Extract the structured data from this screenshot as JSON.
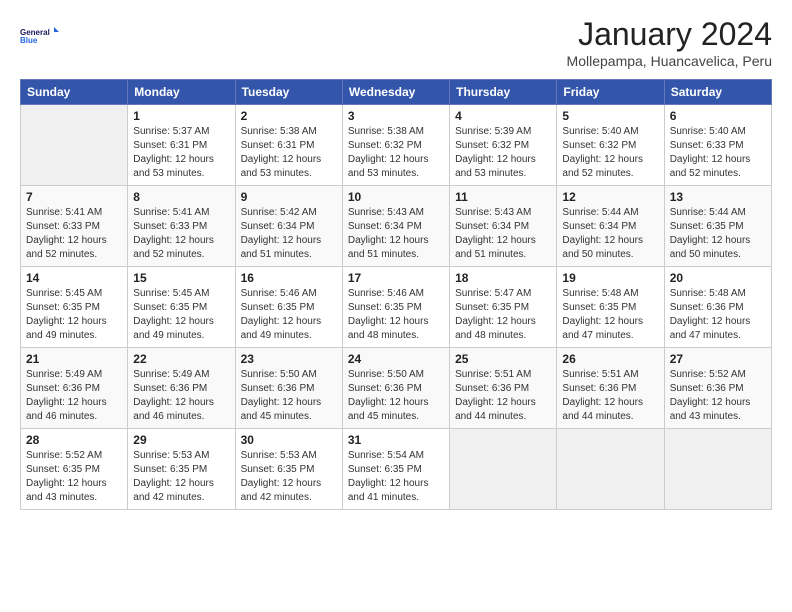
{
  "logo": {
    "line1": "General",
    "line2": "Blue"
  },
  "title": "January 2024",
  "subtitle": "Mollepampa, Huancavelica, Peru",
  "days_header": [
    "Sunday",
    "Monday",
    "Tuesday",
    "Wednesday",
    "Thursday",
    "Friday",
    "Saturday"
  ],
  "weeks": [
    [
      {
        "num": "",
        "info": ""
      },
      {
        "num": "1",
        "info": "Sunrise: 5:37 AM\nSunset: 6:31 PM\nDaylight: 12 hours\nand 53 minutes."
      },
      {
        "num": "2",
        "info": "Sunrise: 5:38 AM\nSunset: 6:31 PM\nDaylight: 12 hours\nand 53 minutes."
      },
      {
        "num": "3",
        "info": "Sunrise: 5:38 AM\nSunset: 6:32 PM\nDaylight: 12 hours\nand 53 minutes."
      },
      {
        "num": "4",
        "info": "Sunrise: 5:39 AM\nSunset: 6:32 PM\nDaylight: 12 hours\nand 53 minutes."
      },
      {
        "num": "5",
        "info": "Sunrise: 5:40 AM\nSunset: 6:32 PM\nDaylight: 12 hours\nand 52 minutes."
      },
      {
        "num": "6",
        "info": "Sunrise: 5:40 AM\nSunset: 6:33 PM\nDaylight: 12 hours\nand 52 minutes."
      }
    ],
    [
      {
        "num": "7",
        "info": "Sunrise: 5:41 AM\nSunset: 6:33 PM\nDaylight: 12 hours\nand 52 minutes."
      },
      {
        "num": "8",
        "info": "Sunrise: 5:41 AM\nSunset: 6:33 PM\nDaylight: 12 hours\nand 52 minutes."
      },
      {
        "num": "9",
        "info": "Sunrise: 5:42 AM\nSunset: 6:34 PM\nDaylight: 12 hours\nand 51 minutes."
      },
      {
        "num": "10",
        "info": "Sunrise: 5:43 AM\nSunset: 6:34 PM\nDaylight: 12 hours\nand 51 minutes."
      },
      {
        "num": "11",
        "info": "Sunrise: 5:43 AM\nSunset: 6:34 PM\nDaylight: 12 hours\nand 51 minutes."
      },
      {
        "num": "12",
        "info": "Sunrise: 5:44 AM\nSunset: 6:34 PM\nDaylight: 12 hours\nand 50 minutes."
      },
      {
        "num": "13",
        "info": "Sunrise: 5:44 AM\nSunset: 6:35 PM\nDaylight: 12 hours\nand 50 minutes."
      }
    ],
    [
      {
        "num": "14",
        "info": "Sunrise: 5:45 AM\nSunset: 6:35 PM\nDaylight: 12 hours\nand 49 minutes."
      },
      {
        "num": "15",
        "info": "Sunrise: 5:45 AM\nSunset: 6:35 PM\nDaylight: 12 hours\nand 49 minutes."
      },
      {
        "num": "16",
        "info": "Sunrise: 5:46 AM\nSunset: 6:35 PM\nDaylight: 12 hours\nand 49 minutes."
      },
      {
        "num": "17",
        "info": "Sunrise: 5:46 AM\nSunset: 6:35 PM\nDaylight: 12 hours\nand 48 minutes."
      },
      {
        "num": "18",
        "info": "Sunrise: 5:47 AM\nSunset: 6:35 PM\nDaylight: 12 hours\nand 48 minutes."
      },
      {
        "num": "19",
        "info": "Sunrise: 5:48 AM\nSunset: 6:35 PM\nDaylight: 12 hours\nand 47 minutes."
      },
      {
        "num": "20",
        "info": "Sunrise: 5:48 AM\nSunset: 6:36 PM\nDaylight: 12 hours\nand 47 minutes."
      }
    ],
    [
      {
        "num": "21",
        "info": "Sunrise: 5:49 AM\nSunset: 6:36 PM\nDaylight: 12 hours\nand 46 minutes."
      },
      {
        "num": "22",
        "info": "Sunrise: 5:49 AM\nSunset: 6:36 PM\nDaylight: 12 hours\nand 46 minutes."
      },
      {
        "num": "23",
        "info": "Sunrise: 5:50 AM\nSunset: 6:36 PM\nDaylight: 12 hours\nand 45 minutes."
      },
      {
        "num": "24",
        "info": "Sunrise: 5:50 AM\nSunset: 6:36 PM\nDaylight: 12 hours\nand 45 minutes."
      },
      {
        "num": "25",
        "info": "Sunrise: 5:51 AM\nSunset: 6:36 PM\nDaylight: 12 hours\nand 44 minutes."
      },
      {
        "num": "26",
        "info": "Sunrise: 5:51 AM\nSunset: 6:36 PM\nDaylight: 12 hours\nand 44 minutes."
      },
      {
        "num": "27",
        "info": "Sunrise: 5:52 AM\nSunset: 6:36 PM\nDaylight: 12 hours\nand 43 minutes."
      }
    ],
    [
      {
        "num": "28",
        "info": "Sunrise: 5:52 AM\nSunset: 6:35 PM\nDaylight: 12 hours\nand 43 minutes."
      },
      {
        "num": "29",
        "info": "Sunrise: 5:53 AM\nSunset: 6:35 PM\nDaylight: 12 hours\nand 42 minutes."
      },
      {
        "num": "30",
        "info": "Sunrise: 5:53 AM\nSunset: 6:35 PM\nDaylight: 12 hours\nand 42 minutes."
      },
      {
        "num": "31",
        "info": "Sunrise: 5:54 AM\nSunset: 6:35 PM\nDaylight: 12 hours\nand 41 minutes."
      },
      {
        "num": "",
        "info": ""
      },
      {
        "num": "",
        "info": ""
      },
      {
        "num": "",
        "info": ""
      }
    ]
  ]
}
